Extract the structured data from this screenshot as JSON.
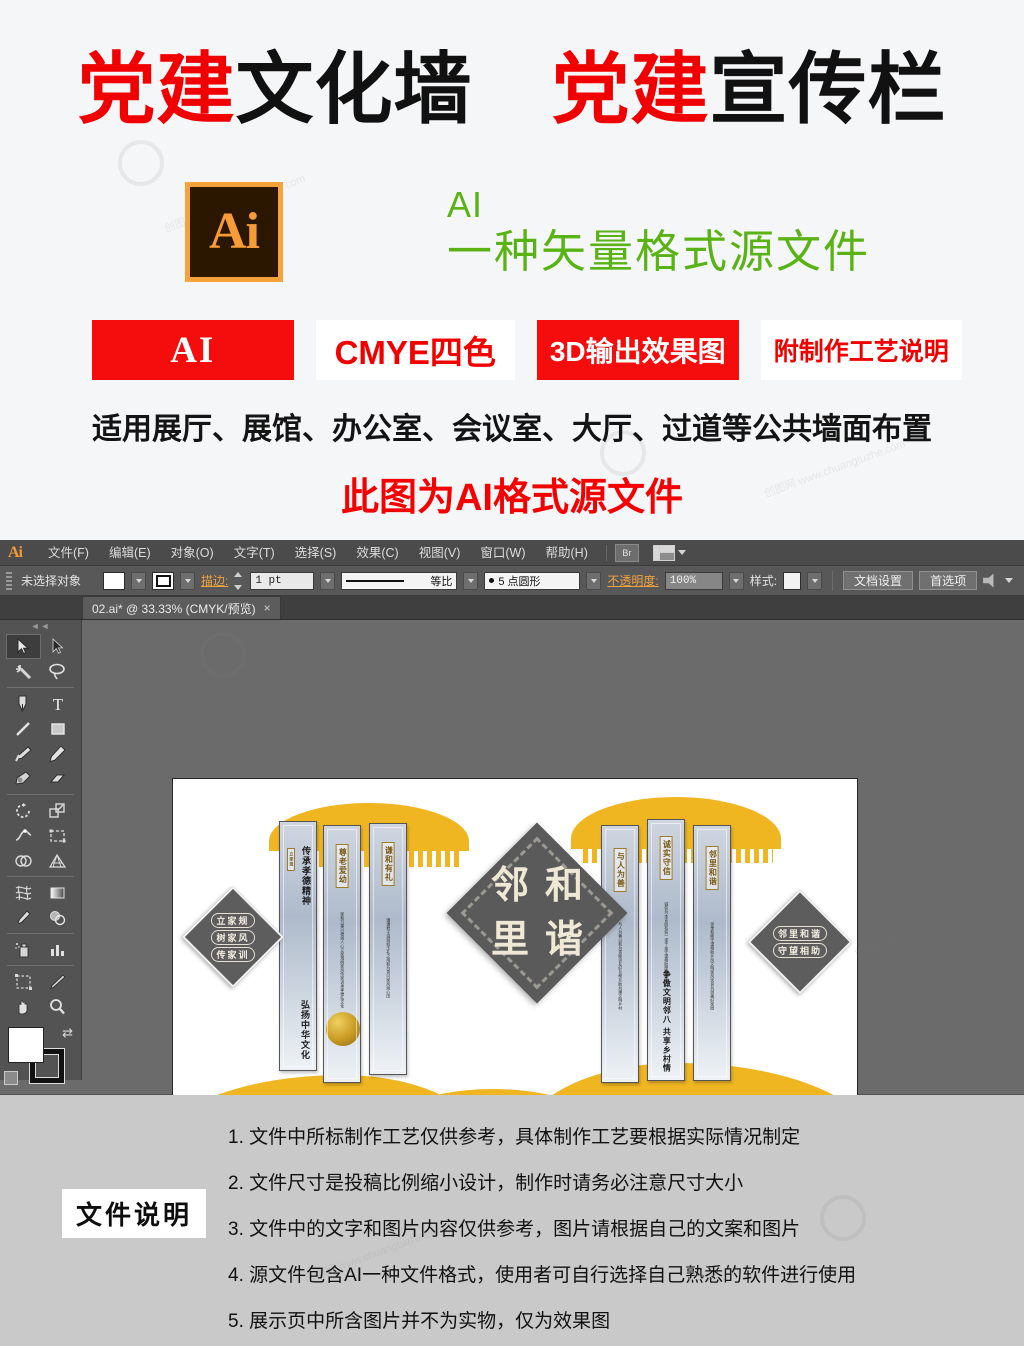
{
  "promo": {
    "title_parts": [
      {
        "text": "党建",
        "color": "red"
      },
      {
        "text": "文化墙",
        "color": "black"
      },
      {
        "text": "　",
        "color": "black"
      },
      {
        "text": "党建",
        "color": "red"
      },
      {
        "text": "宣传栏",
        "color": "black"
      }
    ],
    "ai_logo_text": "Ai",
    "ai_desc_small": "AI",
    "ai_desc_big": "一种矢量格式源文件",
    "badges": [
      "AI",
      "CMYE四色",
      "3D输出效果图",
      "附制作工艺说明"
    ],
    "subtitle": "适用展厅、展馆、办公室、会议室、大厅、过道等公共墙面布置",
    "subtitle2": "此图为AI格式源文件",
    "colors": {
      "red": "#f50000",
      "green": "#5ab314",
      "ai_orange": "#f79b36",
      "ai_dark": "#2b1700"
    },
    "watermark": "创图网 www.chuangtuzhe.com"
  },
  "illustrator": {
    "app_mark": "Ai",
    "menus": [
      "文件(F)",
      "编辑(E)",
      "对象(O)",
      "文字(T)",
      "选择(S)",
      "效果(C)",
      "视图(V)",
      "窗口(W)",
      "帮助(H)"
    ],
    "bridge_button": "Br",
    "control_bar": {
      "selection_status": "未选择对象",
      "stroke_label": "描边:",
      "stroke_weight": "1 pt",
      "profile_label": "等比",
      "brush_label": "5 点圆形",
      "opacity_label": "不透明度:",
      "opacity_value": "100%",
      "style_label": "样式:",
      "doc_setup_button": "文档设置",
      "preferences_button": "首选项"
    },
    "document_tab": {
      "title": "02.ai* @ 33.33% (CMYK/预览)",
      "close": "×"
    },
    "tools": [
      {
        "name": "selection-tool",
        "active": true
      },
      {
        "name": "direct-selection-tool",
        "active": false
      },
      {
        "name": "magic-wand-tool",
        "active": false
      },
      {
        "name": "lasso-tool",
        "active": false
      },
      {
        "name": "pen-tool",
        "active": false
      },
      {
        "name": "type-tool",
        "active": false
      },
      {
        "name": "line-segment-tool",
        "active": false
      },
      {
        "name": "rectangle-tool",
        "active": false
      },
      {
        "name": "paintbrush-tool",
        "active": false
      },
      {
        "name": "pencil-tool",
        "active": false
      },
      {
        "name": "blob-brush-tool",
        "active": false
      },
      {
        "name": "eraser-tool",
        "active": false
      },
      {
        "name": "rotate-tool",
        "active": false
      },
      {
        "name": "scale-tool",
        "active": false
      },
      {
        "name": "width-tool",
        "active": false
      },
      {
        "name": "free-transform-tool",
        "active": false
      },
      {
        "name": "shape-builder-tool",
        "active": false
      },
      {
        "name": "perspective-grid-tool",
        "active": false
      },
      {
        "name": "mesh-tool",
        "active": false
      },
      {
        "name": "gradient-tool",
        "active": false
      },
      {
        "name": "eyedropper-tool",
        "active": false
      },
      {
        "name": "blend-tool",
        "active": false
      },
      {
        "name": "symbol-sprayer-tool",
        "active": false
      },
      {
        "name": "column-graph-tool",
        "active": false
      },
      {
        "name": "artboard-tool",
        "active": false
      },
      {
        "name": "slice-tool",
        "active": false
      },
      {
        "name": "hand-tool",
        "active": false
      },
      {
        "name": "zoom-tool",
        "active": false
      }
    ],
    "artwork": {
      "left_diamond": [
        "立家规",
        "树家风",
        "传家训"
      ],
      "right_diamond": [
        "邻里和谐",
        "守望相助"
      ],
      "center_diamond_chars": [
        "邻",
        "和",
        "里",
        "谐"
      ],
      "left_panels": [
        {
          "title": "传承孝德精神",
          "subtitle": "弘扬中华文化"
        },
        {
          "title": "尊老爱幼",
          "subtitle": ""
        },
        {
          "title": "谦和有礼",
          "subtitle": ""
        }
      ],
      "right_panels": [
        {
          "title": "与人为善",
          "subtitle": ""
        },
        {
          "title": "诚实守信",
          "subtitle": "争做文明邻八 共享乡村情"
        },
        {
          "title": "邻里和谐",
          "subtitle": ""
        }
      ],
      "fans": [
        "立家规",
        "树家风",
        "传家训"
      ],
      "colors": {
        "gold": "#f0b622",
        "panel_dark": "#5a5a5a",
        "panel_cream": "#efe8d4"
      }
    }
  },
  "notes": {
    "badge": "文件说明",
    "items": [
      "1. 文件中所标制作工艺仅供参考，具体制作工艺要根据实际情况制定",
      "2. 文件尺寸是投稿比例缩小设计，制作时请务必注意尺寸大小",
      "3. 文件中的文字和图片内容仅供参考，图片请根据自己的文案和图片",
      "4. 源文件包含AI一种文件格式，使用者可自行选择自己熟悉的软件进行使用",
      "5. 展示页中所含图片并不为实物，仅为效果图"
    ]
  }
}
